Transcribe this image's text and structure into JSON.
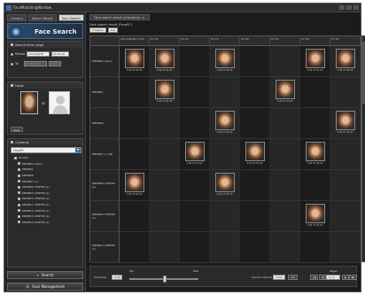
{
  "window": {
    "title": "FaceMatchingWindow"
  },
  "left": {
    "tabs": [
      "Camera",
      "Search Result",
      "Face Search"
    ],
    "banner_title": "Face Search",
    "time_section": {
      "label": "Search time range",
      "from_label": "Period",
      "from_date": "2013/09/26",
      "from_time": "00:00:00",
      "to_label": "To",
      "to_date": "2013/09/26",
      "to_time": "00:00"
    },
    "faces_section": {
      "label": "Faces",
      "connector": "or",
      "clear": "Clear"
    },
    "cameras_section": {
      "label": "Cameras",
      "selected": "FacePC",
      "items": [
        "FacePC",
        "DBMB04 (spot)",
        "DBMB01",
        "DBMB06",
        "DBMB07 (L)",
        "DBMB08 CENTER (L)",
        "DBMB09 CENTER (L)",
        "DBMB10 CENTER (L)",
        "DBMB11 CENTER (L)",
        "DBMB12 CENTER (L)",
        "DBMB13 CENTER (L)",
        "DBMB14 CENTER (L)"
      ]
    },
    "search_button": "Search",
    "face_management_button": "Face Management"
  },
  "main": {
    "tab_label": "Face search result (relevance)",
    "result_info": "Face search result (FacePC)",
    "toolbar": {
      "timeline": "Timeline",
      "list": "List"
    },
    "columns": [
      "2013/09/26 07:00",
      "07:05",
      "07:10",
      "07:15",
      "07:20",
      "07:25",
      "07:30",
      "07:35"
    ],
    "rows": [
      {
        "name": "DBMB04 (spot)",
        "hits": [
          1,
          1,
          0,
          1,
          0,
          0,
          1,
          1
        ]
      },
      {
        "name": "DBMB01",
        "hits": [
          0,
          1,
          0,
          0,
          0,
          1,
          0,
          0
        ]
      },
      {
        "name": "DBMB06",
        "hits": [
          0,
          0,
          0,
          1,
          0,
          0,
          0,
          1
        ]
      },
      {
        "name": "DBMB07 (L CM)",
        "hits": [
          0,
          0,
          1,
          0,
          1,
          0,
          1,
          0
        ]
      },
      {
        "name": "DBMB08 CENTER (L)",
        "hits": [
          1,
          0,
          0,
          1,
          0,
          0,
          0,
          0
        ]
      },
      {
        "name": "DBMB09 CENTER (L)",
        "hits": [
          0,
          0,
          0,
          0,
          0,
          0,
          1,
          0
        ]
      },
      {
        "name": "DBMB10 CENTER (L)",
        "hits": [
          0,
          0,
          0,
          0,
          0,
          0,
          0,
          0
        ]
      }
    ],
    "hit_caption": "0.99\n07:00:00",
    "bottom": {
      "similarity_label": "Similarity",
      "similarity_value": "0.50",
      "min_label": "Min",
      "max_label": "Max",
      "interval_label": "Search interval",
      "interval_value": "1min",
      "set_label": "Set",
      "pages_label": "Pages",
      "page_value": "1 / 1"
    }
  }
}
